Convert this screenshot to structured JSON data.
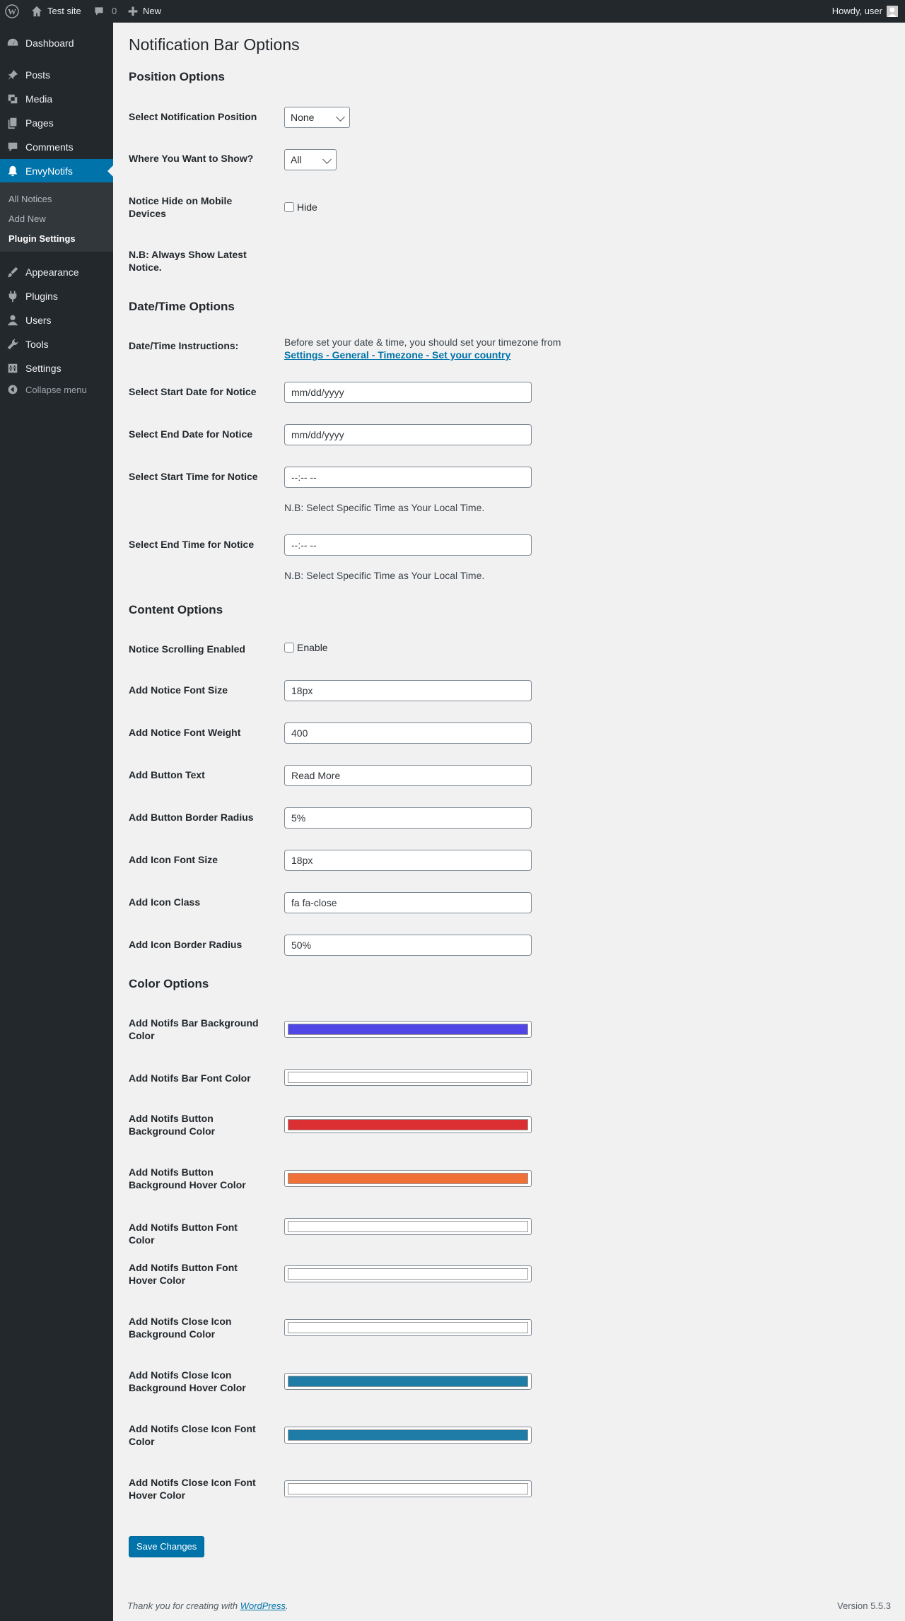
{
  "adminbar": {
    "site_name": "Test site",
    "comments_count": "0",
    "new_label": "New",
    "howdy": "Howdy, user"
  },
  "sidebar": {
    "items": [
      {
        "label": "Dashboard",
        "icon": "dashboard-icon"
      },
      {
        "label": "Posts",
        "icon": "pin-icon"
      },
      {
        "label": "Media",
        "icon": "media-icon"
      },
      {
        "label": "Pages",
        "icon": "pages-icon"
      },
      {
        "label": "Comments",
        "icon": "comment-icon"
      },
      {
        "label": "EnvyNotifs",
        "icon": "bell-icon",
        "active": true
      },
      {
        "label": "Appearance",
        "icon": "brush-icon"
      },
      {
        "label": "Plugins",
        "icon": "plug-icon"
      },
      {
        "label": "Users",
        "icon": "user-icon"
      },
      {
        "label": "Tools",
        "icon": "wrench-icon"
      },
      {
        "label": "Settings",
        "icon": "settings-icon"
      }
    ],
    "submenu": [
      "All Notices",
      "Add New",
      "Plugin Settings"
    ],
    "collapse_label": "Collapse menu"
  },
  "page": {
    "title": "Notification Bar Options",
    "position": {
      "heading": "Position Options",
      "select_position_label": "Select Notification Position",
      "select_position_value": "None",
      "where_show_label": "Where You Want to Show?",
      "where_show_value": "All",
      "hide_mobile_label": "Notice Hide on Mobile Devices",
      "hide_mobile_checkbox": "Hide",
      "nb_latest": "N.B: Always Show Latest Notice."
    },
    "datetime": {
      "heading": "Date/Time Options",
      "instructions_label": "Date/Time Instructions:",
      "instructions_text": "Before set your date & time, you should set your timezone from",
      "instructions_link": "Settings - General - Timezone - Set your country",
      "start_date_label": "Select Start Date for Notice",
      "start_date_value": "mm/dd/yyyy",
      "end_date_label": "Select End Date for Notice",
      "end_date_value": "mm/dd/yyyy",
      "start_time_label": "Select Start Time for Notice",
      "start_time_value": "--:-- --",
      "start_time_note": "N.B: Select Specific Time as Your Local Time.",
      "end_time_label": "Select End Time for Notice",
      "end_time_value": "--:-- --",
      "end_time_note": "N.B: Select Specific Time as Your Local Time."
    },
    "content": {
      "heading": "Content Options",
      "scrolling_label": "Notice Scrolling Enabled",
      "scrolling_checkbox": "Enable",
      "font_size_label": "Add Notice Font Size",
      "font_size_value": "18px",
      "font_weight_label": "Add Notice Font Weight",
      "font_weight_value": "400",
      "button_text_label": "Add Button Text",
      "button_text_value": "Read More",
      "button_radius_label": "Add Button Border Radius",
      "button_radius_value": "5%",
      "icon_size_label": "Add Icon Font Size",
      "icon_size_value": "18px",
      "icon_class_label": "Add Icon Class",
      "icon_class_value": "fa fa-close",
      "icon_radius_label": "Add Icon Border Radius",
      "icon_radius_value": "50%"
    },
    "colors": {
      "heading": "Color Options",
      "items": [
        {
          "label": "Add Notifs Bar Background Color",
          "color": "#4f46e5"
        },
        {
          "label": "Add Notifs Bar Font Color",
          "color": "#ffffff"
        },
        {
          "label": "Add Notifs Button Background Color",
          "color": "#dc2f34"
        },
        {
          "label": "Add Notifs Button Background Hover Color",
          "color": "#f07137"
        },
        {
          "label": "Add Notifs Button Font Color",
          "color": "#ffffff"
        },
        {
          "label": "Add Notifs Button Font Hover Color",
          "color": "#ffffff"
        },
        {
          "label": "Add Notifs Close Icon Background Color",
          "color": "#ffffff"
        },
        {
          "label": "Add Notifs Close Icon Background Hover Color",
          "color": "#1e7ca6"
        },
        {
          "label": "Add Notifs Close Icon Font Color",
          "color": "#1e7ca6"
        },
        {
          "label": "Add Notifs Close Icon Font Hover Color",
          "color": "#ffffff"
        }
      ]
    },
    "save_label": "Save Changes"
  },
  "footer": {
    "thanks_text": "Thank you for creating with",
    "thanks_link": "WordPress",
    "version": "Version 5.5.3"
  }
}
